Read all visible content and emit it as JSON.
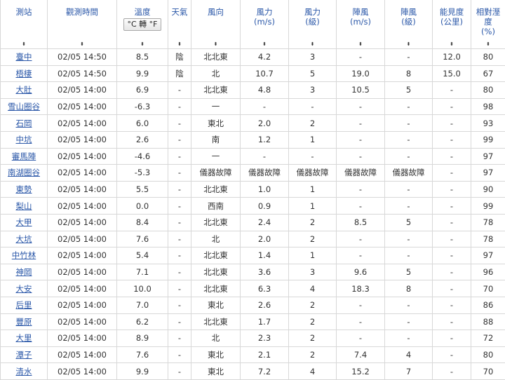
{
  "columns": [
    {
      "label": [
        "測站"
      ]
    },
    {
      "label": [
        "觀測時間"
      ]
    },
    {
      "label": [
        "溫度"
      ],
      "toggle": "°C 轉 °F"
    },
    {
      "label": [
        "天氣"
      ]
    },
    {
      "label": [
        "風向"
      ]
    },
    {
      "label": [
        "風力",
        "(m/s)"
      ]
    },
    {
      "label": [
        "風力",
        "(級)"
      ]
    },
    {
      "label": [
        "陣風",
        "(m/s)"
      ]
    },
    {
      "label": [
        "陣風",
        "(級)"
      ]
    },
    {
      "label": [
        "能見度",
        "(公里)"
      ]
    },
    {
      "label": [
        "相對溼度",
        "(%)"
      ]
    }
  ],
  "sort_glyph": "⬍",
  "rows": [
    [
      "臺中",
      "02/05 14:50",
      "8.5",
      "陰",
      "北北東",
      "4.2",
      "3",
      "-",
      "-",
      "12.0",
      "80"
    ],
    [
      "梧棲",
      "02/05 14:50",
      "9.9",
      "陰",
      "北",
      "10.7",
      "5",
      "19.0",
      "8",
      "15.0",
      "67"
    ],
    [
      "大肚",
      "02/05 14:00",
      "6.9",
      "-",
      "北北東",
      "4.8",
      "3",
      "10.5",
      "5",
      "-",
      "80"
    ],
    [
      "雪山圈谷",
      "02/05 14:00",
      "-6.3",
      "-",
      "一",
      "-",
      "-",
      "-",
      "-",
      "-",
      "98"
    ],
    [
      "石岡",
      "02/05 14:00",
      "6.0",
      "-",
      "東北",
      "2.0",
      "2",
      "-",
      "-",
      "-",
      "93"
    ],
    [
      "中坑",
      "02/05 14:00",
      "2.6",
      "-",
      "南",
      "1.2",
      "1",
      "-",
      "-",
      "-",
      "99"
    ],
    [
      "審馬陣",
      "02/05 14:00",
      "-4.6",
      "-",
      "一",
      "-",
      "-",
      "-",
      "-",
      "-",
      "97"
    ],
    [
      "南湖圈谷",
      "02/05 14:00",
      "-5.3",
      "-",
      "儀器故障",
      "儀器故障",
      "儀器故障",
      "儀器故障",
      "儀器故障",
      "-",
      "97"
    ],
    [
      "東勢",
      "02/05 14:00",
      "5.5",
      "-",
      "北北東",
      "1.0",
      "1",
      "-",
      "-",
      "-",
      "90"
    ],
    [
      "梨山",
      "02/05 14:00",
      "0.0",
      "-",
      "西南",
      "0.9",
      "1",
      "-",
      "-",
      "-",
      "99"
    ],
    [
      "大甲",
      "02/05 14:00",
      "8.4",
      "-",
      "北北東",
      "2.4",
      "2",
      "8.5",
      "5",
      "-",
      "78"
    ],
    [
      "大坑",
      "02/05 14:00",
      "7.6",
      "-",
      "北",
      "2.0",
      "2",
      "-",
      "-",
      "-",
      "78"
    ],
    [
      "中竹林",
      "02/05 14:00",
      "5.4",
      "-",
      "北北東",
      "1.4",
      "1",
      "-",
      "-",
      "-",
      "97"
    ],
    [
      "神岡",
      "02/05 14:00",
      "7.1",
      "-",
      "北北東",
      "3.6",
      "3",
      "9.6",
      "5",
      "-",
      "96"
    ],
    [
      "大安",
      "02/05 14:00",
      "10.0",
      "-",
      "北北東",
      "6.3",
      "4",
      "18.3",
      "8",
      "-",
      "70"
    ],
    [
      "后里",
      "02/05 14:00",
      "7.0",
      "-",
      "東北",
      "2.6",
      "2",
      "-",
      "-",
      "-",
      "86"
    ],
    [
      "豐原",
      "02/05 14:00",
      "6.2",
      "-",
      "北北東",
      "1.7",
      "2",
      "-",
      "-",
      "-",
      "88"
    ],
    [
      "大里",
      "02/05 14:00",
      "8.9",
      "-",
      "北",
      "2.3",
      "2",
      "-",
      "-",
      "-",
      "72"
    ],
    [
      "潭子",
      "02/05 14:00",
      "7.6",
      "-",
      "東北",
      "2.1",
      "2",
      "7.4",
      "4",
      "-",
      "80"
    ],
    [
      "清水",
      "02/05 14:00",
      "9.9",
      "-",
      "東北",
      "7.2",
      "4",
      "15.2",
      "7",
      "-",
      "70"
    ]
  ]
}
